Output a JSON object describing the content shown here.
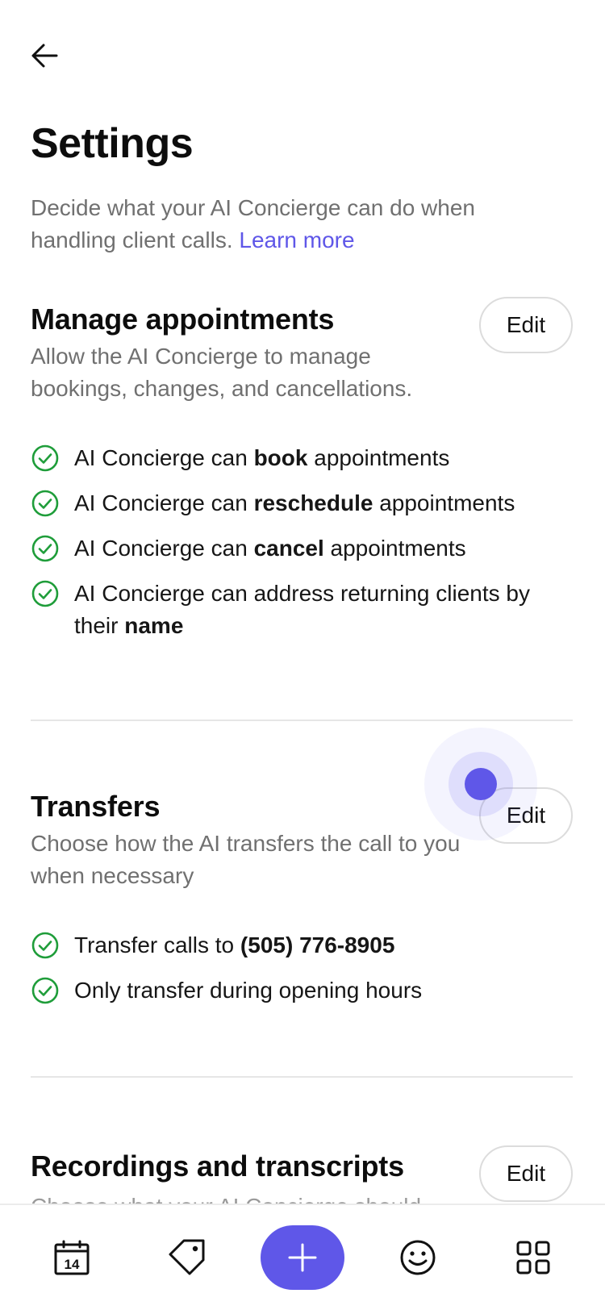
{
  "header": {
    "back_icon": "arrow-left-icon",
    "title": "Settings"
  },
  "intro": {
    "text": "Decide what your AI Concierge can do when handling client calls.",
    "link": "Learn more"
  },
  "sections": {
    "appointments": {
      "title": "Manage appointments",
      "description": "Allow the AI Concierge to manage bookings, changes, and cancellations.",
      "edit_label": "Edit",
      "items": [
        {
          "prefix": "AI Concierge can ",
          "bold": "book",
          "suffix": " appointments"
        },
        {
          "prefix": "AI Concierge can ",
          "bold": "reschedule",
          "suffix": " appointments"
        },
        {
          "prefix": "AI Concierge can ",
          "bold": "cancel",
          "suffix": " appointments"
        },
        {
          "prefix": "AI Concierge can address returning clients by their ",
          "bold": "name",
          "suffix": ""
        }
      ]
    },
    "transfers": {
      "title": "Transfers",
      "description": "Choose how the AI transfers the call to you when necessary",
      "edit_label": "Edit",
      "items": [
        {
          "prefix": "Transfer calls to ",
          "bold": "(505) 776-8905",
          "suffix": ""
        },
        {
          "prefix": "Only transfer during opening hours",
          "bold": "",
          "suffix": ""
        }
      ]
    },
    "recordings": {
      "title": "Recordings and transcripts",
      "description": "Choose what your AI Concierge should",
      "edit_label": "Edit"
    }
  },
  "bottom_nav": {
    "calendar_day": "14",
    "items": [
      "calendar-icon",
      "tag-icon",
      "plus-icon",
      "smiley-icon",
      "grid-icon"
    ]
  },
  "colors": {
    "accent": "#5f57e8",
    "check_green": "#1f9d3a",
    "muted_text": "#707070"
  }
}
